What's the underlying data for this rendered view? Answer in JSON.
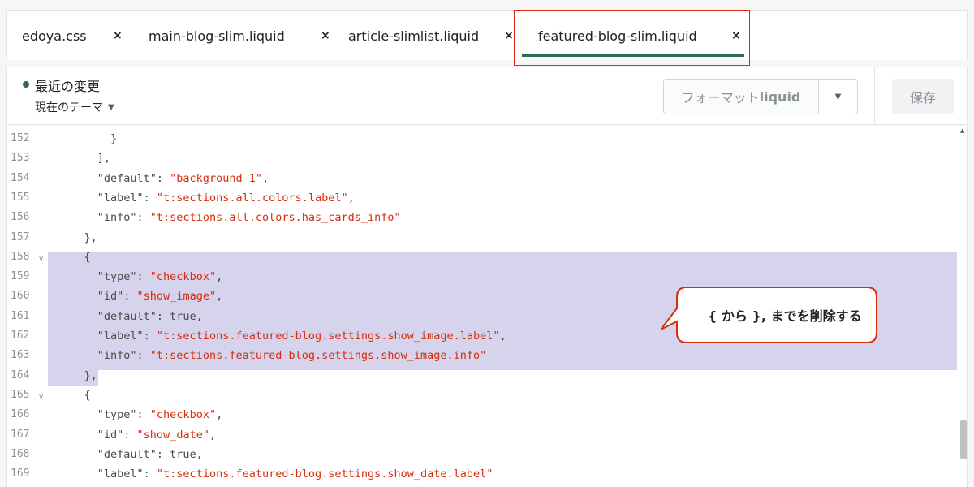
{
  "tabs": [
    {
      "label": "edoya.css",
      "close": "×"
    },
    {
      "label": "main-blog-slim.liquid",
      "close": "×"
    },
    {
      "label": "article-slimlist.liquid",
      "close": "×"
    },
    {
      "label": "featured-blog-slim.liquid",
      "close": "×",
      "active": true
    }
  ],
  "header": {
    "status": "最近の変更",
    "theme": "現在のテーマ",
    "format_prefix": "フォーマット",
    "format_suffix": "liquid",
    "save": "保存"
  },
  "editor": {
    "lines": [
      {
        "n": "152",
        "fold": "",
        "parts": [
          [
            "p",
            "        }"
          ]
        ]
      },
      {
        "n": "153",
        "fold": "",
        "parts": [
          [
            "p",
            "      ],"
          ]
        ]
      },
      {
        "n": "154",
        "fold": "",
        "parts": [
          [
            "p",
            "      \"default\": "
          ],
          [
            "s",
            "\"background-1\""
          ],
          [
            "p",
            ","
          ]
        ]
      },
      {
        "n": "155",
        "fold": "",
        "parts": [
          [
            "p",
            "      \"label\": "
          ],
          [
            "s",
            "\"t:sections.all.colors.label\""
          ],
          [
            "p",
            ","
          ]
        ]
      },
      {
        "n": "156",
        "fold": "",
        "parts": [
          [
            "p",
            "      \"info\": "
          ],
          [
            "s",
            "\"t:sections.all.colors.has_cards_info\""
          ]
        ]
      },
      {
        "n": "157",
        "fold": "",
        "parts": [
          [
            "p",
            "    },"
          ]
        ]
      },
      {
        "n": "158",
        "fold": "v",
        "parts": [
          [
            "p",
            "    {"
          ]
        ]
      },
      {
        "n": "159",
        "fold": "",
        "parts": [
          [
            "p",
            "      \"type\": "
          ],
          [
            "s",
            "\"checkbox\""
          ],
          [
            "p",
            ","
          ]
        ]
      },
      {
        "n": "160",
        "fold": "",
        "parts": [
          [
            "p",
            "      \"id\": "
          ],
          [
            "s",
            "\"show_image\""
          ],
          [
            "p",
            ","
          ]
        ]
      },
      {
        "n": "161",
        "fold": "",
        "parts": [
          [
            "p",
            "      \"default\": true,"
          ]
        ]
      },
      {
        "n": "162",
        "fold": "",
        "parts": [
          [
            "p",
            "      \"label\": "
          ],
          [
            "s",
            "\"t:sections.featured-blog.settings.show_image.label\""
          ],
          [
            "p",
            ","
          ]
        ]
      },
      {
        "n": "163",
        "fold": "",
        "parts": [
          [
            "p",
            "      \"info\": "
          ],
          [
            "s",
            "\"t:sections.featured-blog.settings.show_image.info\""
          ]
        ]
      },
      {
        "n": "164",
        "fold": "",
        "parts": [
          [
            "p",
            "    },"
          ]
        ]
      },
      {
        "n": "165",
        "fold": "v",
        "parts": [
          [
            "p",
            "    {"
          ]
        ]
      },
      {
        "n": "166",
        "fold": "",
        "parts": [
          [
            "p",
            "      \"type\": "
          ],
          [
            "s",
            "\"checkbox\""
          ],
          [
            "p",
            ","
          ]
        ]
      },
      {
        "n": "167",
        "fold": "",
        "parts": [
          [
            "p",
            "      \"id\": "
          ],
          [
            "s",
            "\"show_date\""
          ],
          [
            "p",
            ","
          ]
        ]
      },
      {
        "n": "168",
        "fold": "",
        "parts": [
          [
            "p",
            "      \"default\": true,"
          ]
        ]
      },
      {
        "n": "169",
        "fold": "",
        "parts": [
          [
            "p",
            "      \"label\": "
          ],
          [
            "s",
            "\"t:sections.featured-blog.settings.show_date.label\""
          ]
        ]
      }
    ]
  },
  "callout": {
    "text": "{ から }, までを削除する"
  },
  "colors": {
    "accent": "#2f6b4f",
    "highlight": "#d72c0d",
    "selection": "#d6d3ec",
    "string": "#d72c0d"
  }
}
